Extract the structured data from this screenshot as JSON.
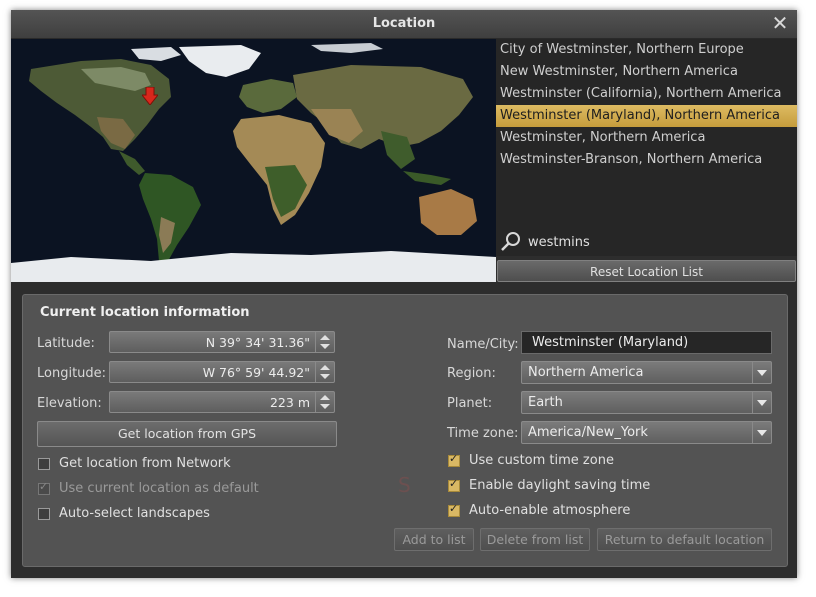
{
  "window": {
    "title": "Location"
  },
  "colors": {
    "accent": "#d9b864",
    "selected_row": "#d4ad52",
    "panel": "#535353"
  },
  "location_list": {
    "items": [
      "City of Westminster, Northern Europe",
      "New Westminster, Northern America",
      "Westminster (California), Northern America",
      "Westminster (Maryland), Northern America",
      "Westminster, Northern America",
      "Westminster-Branson, Northern America"
    ],
    "selected_index": 3,
    "search_value": "westmins",
    "reset_label": "Reset Location List"
  },
  "info": {
    "title": "Current location information",
    "latitude_label": "Latitude:",
    "latitude_value": "N 39° 34' 31.36\"",
    "longitude_label": "Longitude:",
    "longitude_value": "W 76° 59' 44.92\"",
    "elevation_label": "Elevation:",
    "elevation_value": "223 m",
    "gps_button": "Get location from GPS",
    "network_label": "Get location from Network",
    "default_label": "Use current location as default",
    "landscapes_label": "Auto-select landscapes",
    "name_label": "Name/City:",
    "name_value": "Westminster (Maryland)",
    "region_label": "Region:",
    "region_value": "Northern America",
    "planet_label": "Planet:",
    "planet_value": "Earth",
    "timezone_label": "Time zone:",
    "timezone_value": "America/New_York",
    "custom_tz_label": "Use custom time zone",
    "dst_label": "Enable daylight saving time",
    "atmosphere_label": "Auto-enable atmosphere",
    "add_button": "Add to list",
    "delete_button": "Delete from list",
    "return_button": "Return to default location"
  }
}
